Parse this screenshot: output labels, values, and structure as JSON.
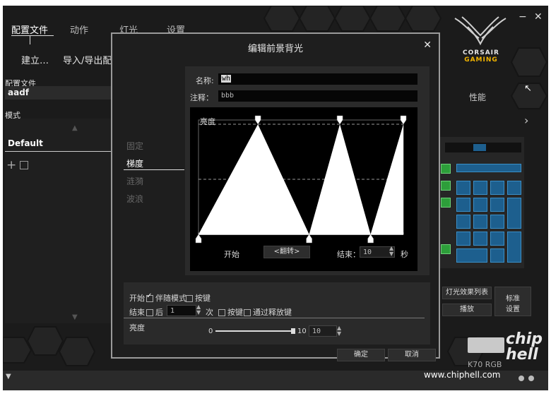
{
  "nav": {
    "tabs": [
      "配置文件",
      "动作",
      "灯光",
      "设置"
    ]
  },
  "window_controls": {
    "minimize": "−",
    "close": "✕"
  },
  "subtoolbar": {
    "create": "建立…",
    "import_export": "导入/导出配"
  },
  "sidebar": {
    "profile_label": "配置文件",
    "profile_value": "aadf",
    "mode_label": "模式",
    "mode_item": "Default",
    "add_icon": "+"
  },
  "brand": {
    "line1": "CORSAIR",
    "line2": "GAMING"
  },
  "right_panel": {
    "performance_tab": "性能",
    "light_effect_list": "灯光效果列表",
    "play": "播放",
    "standard_settings_line1": "标准",
    "standard_settings_line2": "设置",
    "device_name": "K70 RGB"
  },
  "footer": {
    "watermark_url": "www.chiphell.com",
    "logo_text": "chip hell"
  },
  "dialog": {
    "title": "编辑前景背光",
    "close": "✕",
    "effects": [
      "固定",
      "梯度",
      "涟漪",
      "波浪"
    ],
    "active_effect": 1,
    "name_label": "名称:",
    "name_value": "wh",
    "note_label": "注释：",
    "note_value": "bbb",
    "graph": {
      "ylabel": "亮度",
      "start_label": "开始",
      "flip_button": "<翻转>",
      "end_label": "结束：",
      "end_value": "10",
      "unit": "秒",
      "points": [
        [
          0,
          0
        ],
        [
          2.9,
          1
        ],
        [
          5.4,
          0
        ],
        [
          6.9,
          1
        ],
        [
          8.4,
          0
        ],
        [
          10,
          1
        ]
      ]
    },
    "start_row": {
      "label": "开始",
      "follow_mode": "伴随模式",
      "follow_checked": true,
      "keypress": "按键",
      "keypress_checked": false
    },
    "end_row": {
      "label": "结束",
      "after": "后",
      "count_value": "1",
      "times": "次",
      "keypress": "按键",
      "release": "通过释放键"
    },
    "brightness": {
      "label": "亮度",
      "min": "0",
      "max": "10",
      "value": "10",
      "level": 1.0
    },
    "ok": "确定",
    "cancel": "取消"
  },
  "colors": {
    "key_blue": "#1d5f8e",
    "key_green": "#2d9e3a",
    "accent_yellow": "#f2b400"
  }
}
